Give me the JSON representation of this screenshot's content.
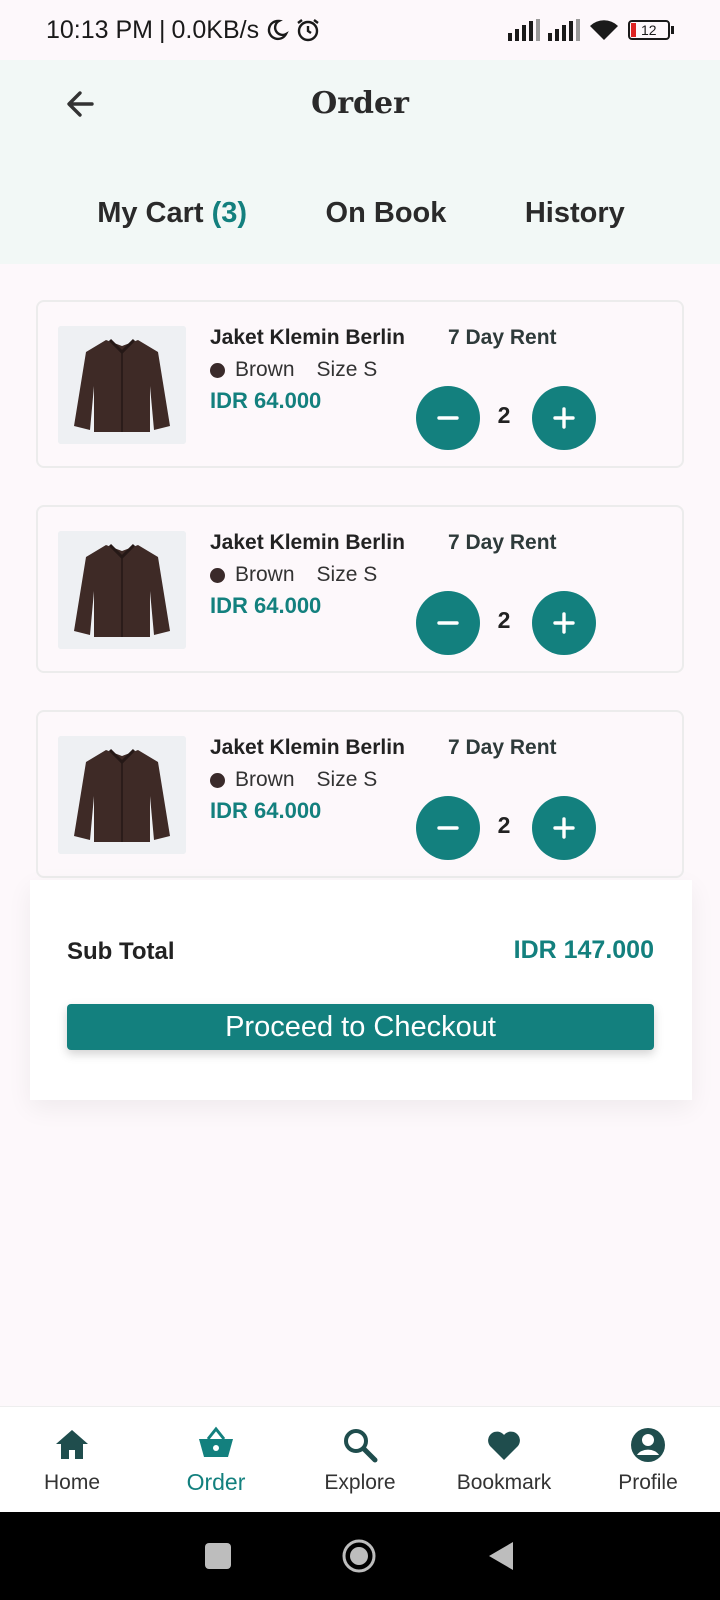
{
  "status_bar": {
    "time": "10:13 PM",
    "speed": "0.0KB/s",
    "battery": "12"
  },
  "header": {
    "title": "Order"
  },
  "tabs": [
    {
      "label": "My Cart",
      "count": "(3)"
    },
    {
      "label": "On Book"
    },
    {
      "label": "History"
    }
  ],
  "cart": {
    "items": [
      {
        "name": "Jaket Klemin Berlin",
        "rent": "7 Day Rent",
        "color": "Brown",
        "size": "Size S",
        "price": "IDR 64.000",
        "qty": "2"
      },
      {
        "name": "Jaket Klemin Berlin",
        "rent": "7 Day Rent",
        "color": "Brown",
        "size": "Size S",
        "price": "IDR 64.000",
        "qty": "2"
      },
      {
        "name": "Jaket Klemin Berlin",
        "rent": "7 Day Rent",
        "color": "Brown",
        "size": "Size S",
        "price": "IDR 64.000",
        "qty": "2"
      }
    ]
  },
  "summary": {
    "subtotal_label": "Sub Total",
    "subtotal_value": "IDR 147.000",
    "checkout_label": "Proceed to Checkout"
  },
  "bottom_nav": [
    {
      "label": "Home",
      "icon": "home-icon"
    },
    {
      "label": "Order",
      "icon": "basket-icon",
      "active": true
    },
    {
      "label": "Explore",
      "icon": "search-icon"
    },
    {
      "label": "Bookmark",
      "icon": "heart-icon"
    },
    {
      "label": "Profile",
      "icon": "profile-icon"
    }
  ],
  "colors": {
    "accent": "#13807e",
    "nav_icon": "#1f4d4d",
    "header_bg": "#f2f8f6"
  }
}
